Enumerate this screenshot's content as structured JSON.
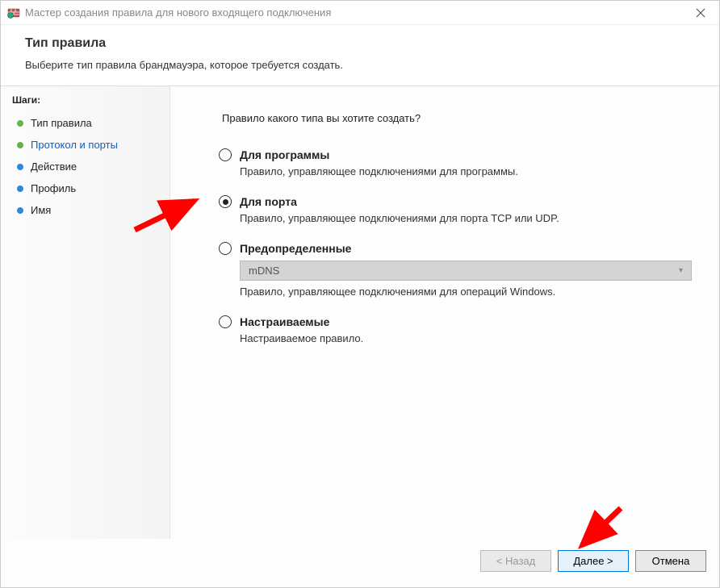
{
  "titlebar": {
    "title": "Мастер создания правила для нового входящего подключения"
  },
  "header": {
    "title": "Тип правила",
    "subtitle": "Выберите тип правила брандмауэра, которое требуется создать."
  },
  "sidebar": {
    "title": "Шаги:",
    "steps": [
      {
        "label": "Тип правила"
      },
      {
        "label": "Протокол и порты"
      },
      {
        "label": "Действие"
      },
      {
        "label": "Профиль"
      },
      {
        "label": "Имя"
      }
    ]
  },
  "main": {
    "question": "Правило какого типа вы хотите создать?",
    "options": {
      "program": {
        "label": "Для программы",
        "desc": "Правило, управляющее подключениями для программы."
      },
      "port": {
        "label": "Для порта",
        "desc": "Правило, управляющее подключениями для порта TCP или UDP."
      },
      "predefined": {
        "label": "Предопределенные",
        "dropdown": "mDNS",
        "desc": "Правило, управляющее подключениями для операций Windows."
      },
      "custom": {
        "label": "Настраиваемые",
        "desc": "Настраиваемое правило."
      }
    }
  },
  "footer": {
    "back": "< Назад",
    "next": "Далее >",
    "cancel": "Отмена"
  }
}
